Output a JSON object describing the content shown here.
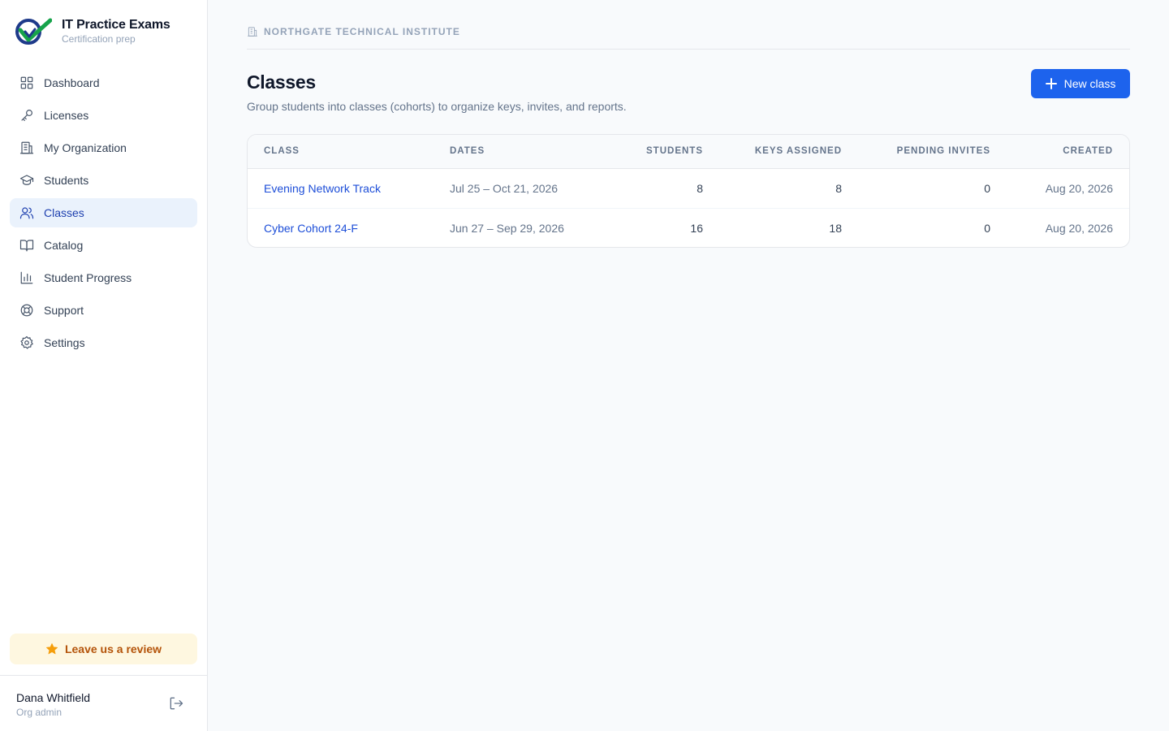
{
  "brand": {
    "title": "IT Practice Exams",
    "subtitle": "Certification prep"
  },
  "nav": [
    {
      "label": "Dashboard",
      "icon": "grid-icon"
    },
    {
      "label": "Licenses",
      "icon": "key-icon"
    },
    {
      "label": "My Organization",
      "icon": "building-icon"
    },
    {
      "label": "Students",
      "icon": "graduation-cap-icon"
    },
    {
      "label": "Classes",
      "icon": "users-icon",
      "active": true
    },
    {
      "label": "Catalog",
      "icon": "book-open-icon"
    },
    {
      "label": "Student Progress",
      "icon": "bar-chart-icon"
    },
    {
      "label": "Support",
      "icon": "lifebuoy-icon"
    },
    {
      "label": "Settings",
      "icon": "gear-icon"
    }
  ],
  "review": {
    "label": "Leave us a review"
  },
  "user": {
    "name": "Dana Whitfield",
    "role": "Org admin"
  },
  "org": {
    "name": "NORTHGATE TECHNICAL INSTITUTE"
  },
  "page": {
    "title": "Classes",
    "subtitle": "Group students into classes (cohorts) to organize keys, invites, and reports.",
    "new_button": "New class"
  },
  "table": {
    "headers": [
      "CLASS",
      "DATES",
      "STUDENTS",
      "KEYS ASSIGNED",
      "PENDING INVITES",
      "CREATED"
    ],
    "rows": [
      {
        "name": "Evening Network Track",
        "dates": "Jul 25 – Oct 21, 2026",
        "students": "8",
        "keys": "8",
        "pending": "0",
        "created": "Aug 20, 2026"
      },
      {
        "name": "Cyber Cohort 24-F",
        "dates": "Jun 27 – Sep 29, 2026",
        "students": "16",
        "keys": "18",
        "pending": "0",
        "created": "Aug 20, 2026"
      }
    ]
  },
  "colors": {
    "accent": "#1d63ed",
    "active_nav_bg": "#eaf2fc",
    "link": "#1d4ed8",
    "review_bg": "#fef7e0",
    "review_text": "#b45309"
  }
}
